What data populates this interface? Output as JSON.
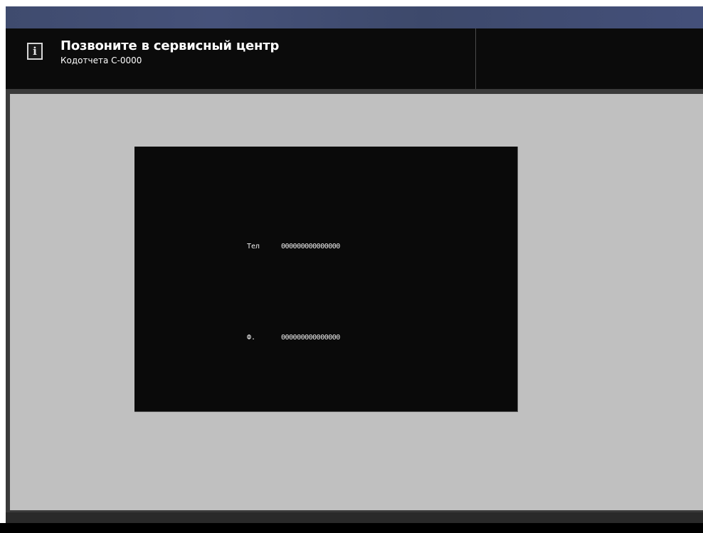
{
  "header": {
    "title": "Позвоните в сервисный центр",
    "subtitle": "Кодотчета С-0000",
    "icon": "info-icon",
    "icon_glyph": "i"
  },
  "contact_panel": {
    "rows": [
      {
        "label": "Тел",
        "value": "000000000000000"
      },
      {
        "label": "Ф.",
        "value": "000000000000000"
      }
    ]
  },
  "colors": {
    "header_bg": "#0b0b0b",
    "content_bg": "#c0c0c0",
    "panel_bg": "#0a0a0a",
    "top_strip": "#434f75"
  }
}
